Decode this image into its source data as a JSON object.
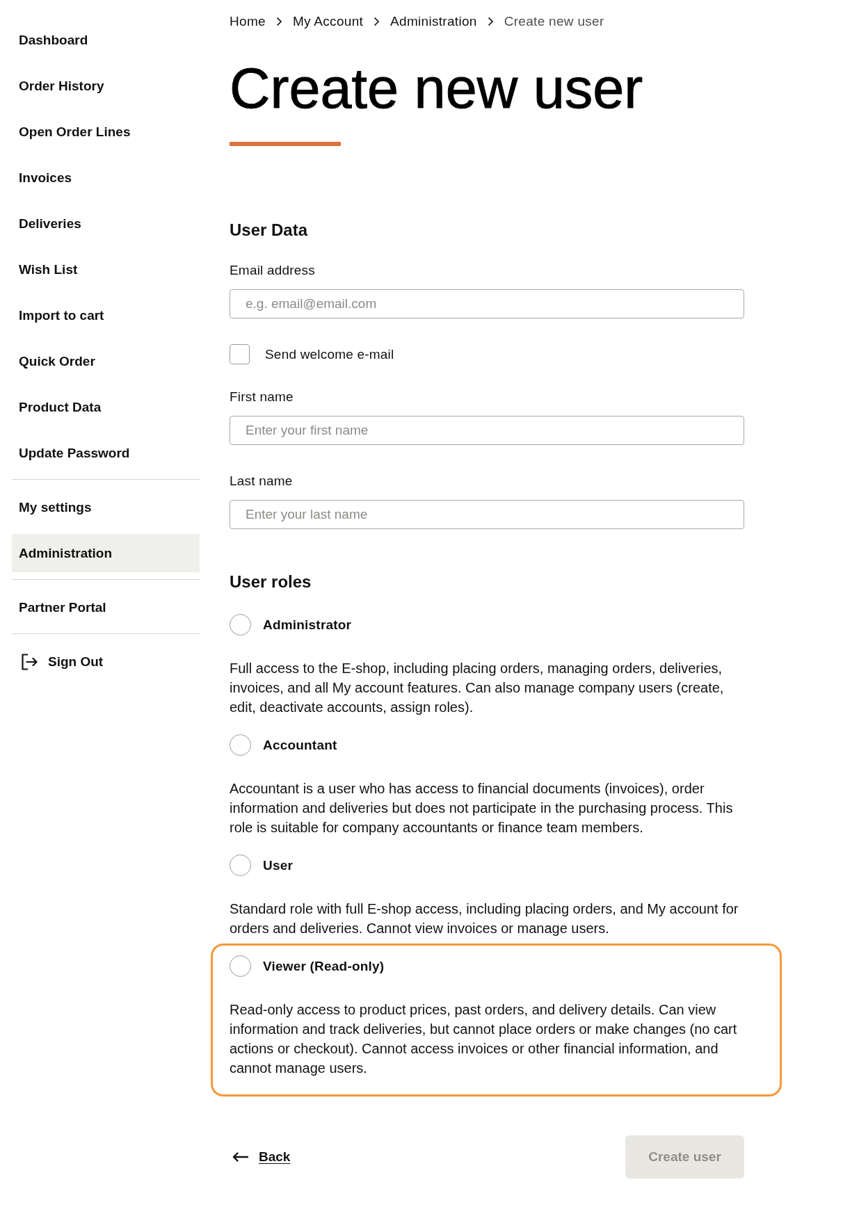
{
  "sidebar": {
    "sections": [
      {
        "items": [
          {
            "label": "Dashboard",
            "selected": false
          },
          {
            "label": "Order History",
            "selected": false
          },
          {
            "label": "Open Order Lines",
            "selected": false
          },
          {
            "label": "Invoices",
            "selected": false
          },
          {
            "label": "Deliveries",
            "selected": false
          },
          {
            "label": "Wish List",
            "selected": false
          },
          {
            "label": "Import to cart",
            "selected": false
          },
          {
            "label": "Quick Order",
            "selected": false
          },
          {
            "label": "Product Data",
            "selected": false
          },
          {
            "label": "Update Password",
            "selected": false
          }
        ]
      },
      {
        "items": [
          {
            "label": "My settings",
            "selected": false
          },
          {
            "label": "Administration",
            "selected": true
          }
        ]
      },
      {
        "items": [
          {
            "label": "Partner Portal",
            "selected": false
          }
        ]
      }
    ],
    "sign_out": {
      "label": "Sign Out"
    }
  },
  "breadcrumb": [
    {
      "label": "Home",
      "current": false
    },
    {
      "label": "My Account",
      "current": false
    },
    {
      "label": "Administration",
      "current": false
    },
    {
      "label": "Create new user",
      "current": true
    }
  ],
  "title": "Create new user",
  "user_data": {
    "heading": "User Data",
    "fields": [
      {
        "kind": "text",
        "label": "Email address",
        "placeholder": "e.g. email@email.com"
      },
      {
        "kind": "checkbox",
        "label": "Send welcome e-mail",
        "checked": false
      },
      {
        "kind": "text",
        "label": "First name",
        "placeholder": "Enter your first name"
      },
      {
        "kind": "text",
        "label": "Last name",
        "placeholder": "Enter your last name"
      }
    ]
  },
  "user_roles": {
    "heading": "User roles",
    "roles": [
      {
        "name": "Administrator",
        "description": "Full access to the E-shop, including placing orders, managing orders, deliveries, invoices, and all My account features. Can also manage company users (create, edit, deactivate accounts, assign roles).",
        "selected": false,
        "highlighted": false
      },
      {
        "name": "Accountant",
        "description": "Accountant is a user who has access to financial documents (invoices), order information and deliveries but does not participate in the purchasing process. This role is suitable for company accountants or finance team members.",
        "selected": false,
        "highlighted": false
      },
      {
        "name": "User",
        "description": "Standard role with full E-shop access, including placing orders, and My account for orders and deliveries. Cannot view invoices or manage users.",
        "selected": false,
        "highlighted": false
      },
      {
        "name": "Viewer (Read-only)",
        "description": "Read-only access to product prices, past orders, and delivery details. Can view information and track deliveries, but cannot place orders or make changes (no cart actions or checkout). Cannot access invoices or other financial information, and cannot manage users.",
        "selected": false,
        "highlighted": true
      }
    ]
  },
  "actions": {
    "back": {
      "label": "Back"
    },
    "create": {
      "label": "Create user",
      "disabled": true
    }
  }
}
